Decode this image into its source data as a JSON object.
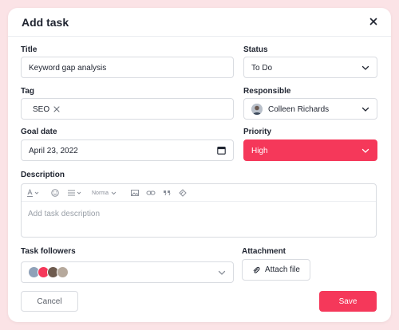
{
  "modal": {
    "title": "Add task"
  },
  "form": {
    "title": {
      "label": "Title",
      "value": "Keyword gap analysis"
    },
    "status": {
      "label": "Status",
      "value": "To Do"
    },
    "tag": {
      "label": "Tag",
      "chips": [
        "SEO"
      ]
    },
    "responsible": {
      "label": "Responsible",
      "value": "Colleen Richards"
    },
    "goal_date": {
      "label": "Goal date",
      "value": "April 23, 2022"
    },
    "priority": {
      "label": "Priority",
      "value": "High"
    },
    "description": {
      "label": "Description",
      "placeholder": "Add task description",
      "toolbar": {
        "text_style": "Norma"
      }
    },
    "followers": {
      "label": "Task followers"
    },
    "attachment": {
      "label": "Attachment",
      "button_label": "Attach file"
    }
  },
  "actions": {
    "cancel_label": "Cancel",
    "save_label": "Save"
  },
  "colors": {
    "accent": "#f5385a",
    "background": "#fbe3e6"
  },
  "icons": [
    "close-icon",
    "chevron-down-icon",
    "calendar-icon",
    "paperclip-icon",
    "text-color-icon",
    "emoji-icon",
    "list-icon",
    "image-icon",
    "link-icon",
    "quote-icon",
    "eraser-icon"
  ]
}
